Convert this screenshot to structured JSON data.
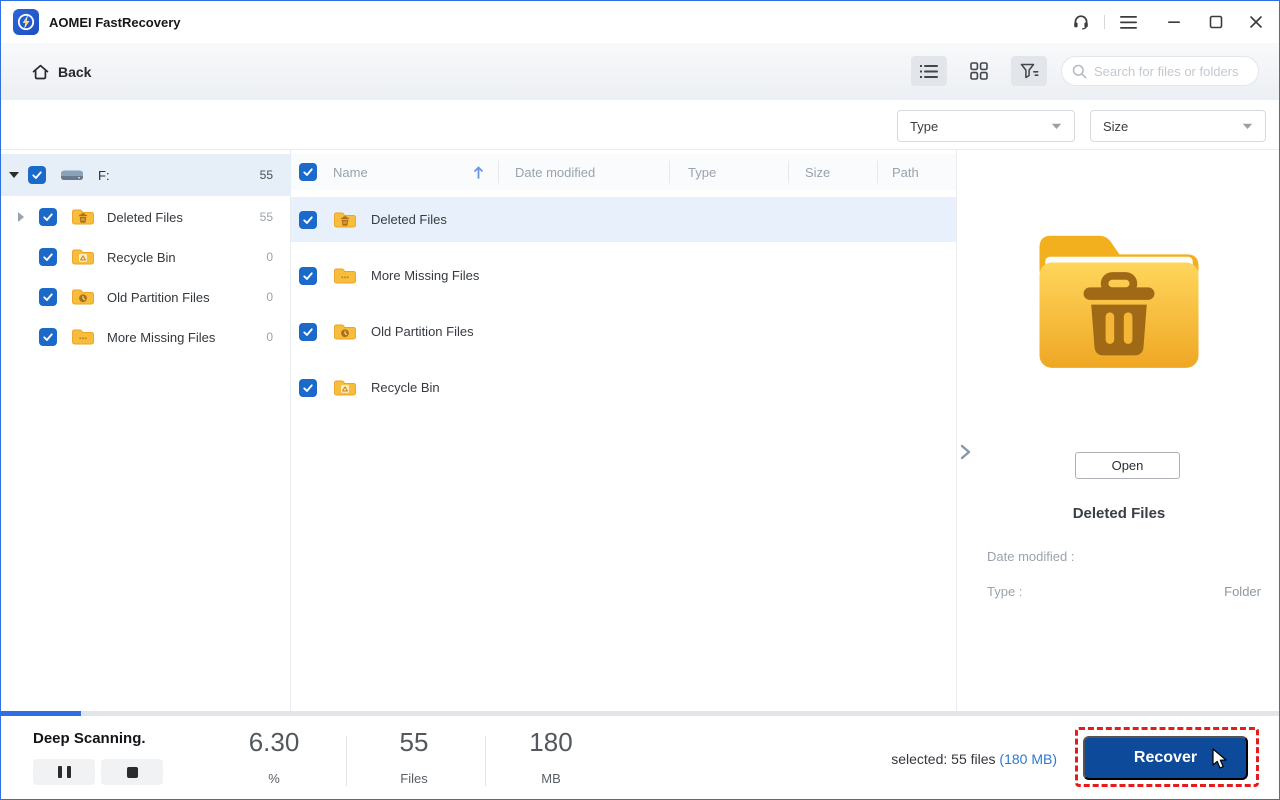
{
  "titlebar": {
    "title": "AOMEI FastRecovery",
    "icons": {
      "logo": "lightning-bolt-badge",
      "support": "headset",
      "menu": "hamburger",
      "minimize": "minus",
      "maximize": "square-outline",
      "close": "x"
    }
  },
  "nav": {
    "back_label": "Back",
    "search_placeholder": "Search for files or folders",
    "view_buttons": [
      {
        "name": "list-view",
        "active": true
      },
      {
        "name": "grid-view",
        "active": false
      },
      {
        "name": "filter-view",
        "active": true
      }
    ]
  },
  "filters": {
    "type_label": "Type",
    "size_label": "Size"
  },
  "sidebar": {
    "root": {
      "label": "F:",
      "count": "55",
      "checked": true,
      "expanded": true
    },
    "items": [
      {
        "label": "Deleted Files",
        "count": "55",
        "emblem": "trash-folder-icon",
        "checked": true,
        "collapsible": true
      },
      {
        "label": "Recycle Bin",
        "count": "0",
        "emblem": "recycle-folder-icon",
        "checked": true
      },
      {
        "label": "Old Partition Files",
        "count": "0",
        "emblem": "clock-folder-icon",
        "checked": true
      },
      {
        "label": "More Missing Files",
        "count": "0",
        "emblem": "dots-folder-icon",
        "checked": true
      }
    ]
  },
  "table": {
    "columns": {
      "name": "Name",
      "date_modified": "Date modified",
      "type": "Type",
      "size": "Size",
      "path": "Path"
    },
    "sort": {
      "column": "Name",
      "direction": "ascending"
    },
    "rows": [
      {
        "name": "Deleted Files",
        "emblem": "trash-folder-icon",
        "checked": true,
        "selected": true
      },
      {
        "name": "More Missing Files",
        "emblem": "dots-folder-icon",
        "checked": true
      },
      {
        "name": "Old Partition Files",
        "emblem": "clock-folder-icon",
        "checked": true
      },
      {
        "name": "Recycle Bin",
        "emblem": "recycle-folder-icon",
        "checked": true
      }
    ]
  },
  "preview": {
    "open_label": "Open",
    "title": "Deleted Files",
    "date_modified_label": "Date modified :",
    "date_modified_value": "",
    "type_label": "Type :",
    "type_value": "Folder"
  },
  "statusbar": {
    "status": "Deep Scanning.",
    "stats": [
      {
        "value": "6.30",
        "unit": "%"
      },
      {
        "value": "55",
        "unit": "Files"
      },
      {
        "value": "180",
        "unit": "MB"
      }
    ],
    "selected_text": "selected: 55 files",
    "selected_size": "(180 MB)",
    "recover_label": "Recover"
  },
  "colors": {
    "accent_blue": "#2e6fe4",
    "checkbox_blue": "#1b6ac9",
    "recover_button_blue": "#0d4a99",
    "link_blue": "#2e77d0",
    "row_highlight": "#e8f1fb",
    "sidebar_highlight": "#e6eef8",
    "folder_yellow": "#f9bd3d",
    "folder_emblem_brown": "#a9711c",
    "red_dashed_highlight": "#e51c1c"
  }
}
